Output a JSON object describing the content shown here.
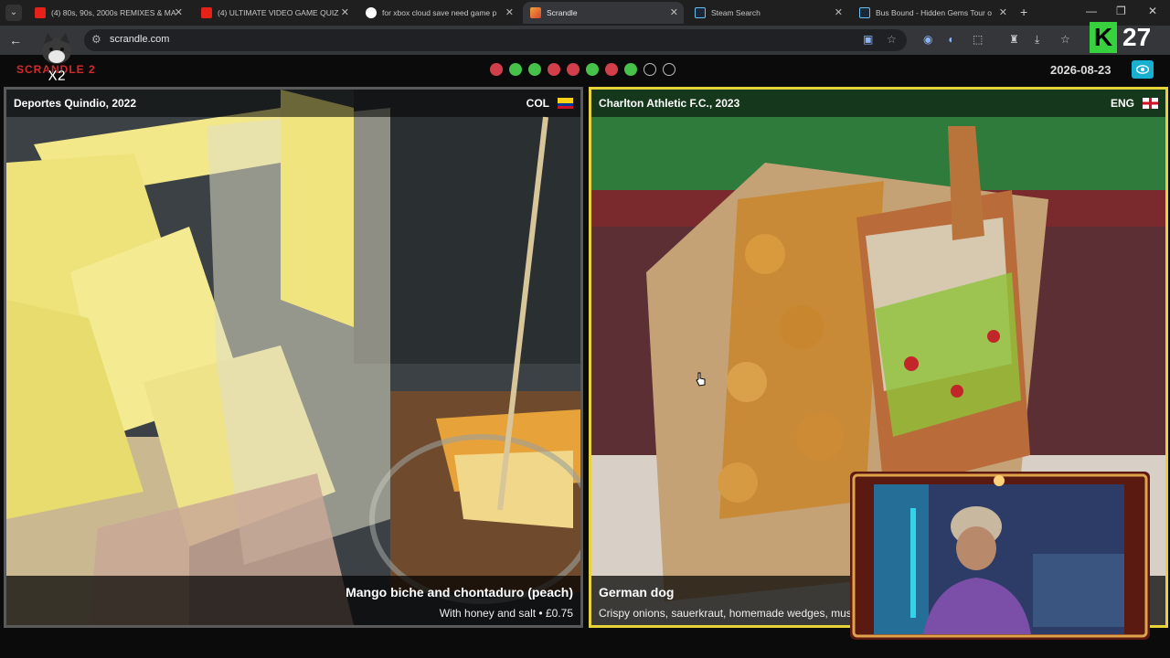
{
  "browser": {
    "tabs": [
      {
        "title": "(4) 80s, 90s, 2000s REMIXES & MA",
        "icon": "youtube-icon",
        "active": false
      },
      {
        "title": "(4) ULTIMATE VIDEO GAME QUIZ",
        "icon": "youtube-icon",
        "active": false
      },
      {
        "title": "for xbox cloud save need game p",
        "icon": "google-icon",
        "active": false
      },
      {
        "title": "Scrandle",
        "icon": "scrandle-icon",
        "active": true
      },
      {
        "title": "Steam Search",
        "icon": "steam-icon",
        "active": false
      },
      {
        "title": "Bus Bound - Hidden Gems Tour o",
        "icon": "steam-icon",
        "active": false
      }
    ],
    "url": "scrandle.com",
    "overlay_badge": {
      "letter": "K",
      "number": "27"
    }
  },
  "game": {
    "logo": "SCRANDLE 2",
    "streak_badge": "X2",
    "progress": [
      "wrong",
      "right",
      "right",
      "wrong",
      "wrong",
      "right",
      "wrong",
      "right",
      "empty",
      "empty"
    ],
    "date": "2026-08-23",
    "colors": {
      "wrong": "#d1404a",
      "right": "#46c14a",
      "selected_border": "#e6d33a",
      "accent": "#18b0d0"
    }
  },
  "cards": {
    "left": {
      "team": "Deportes Quindio, 2022",
      "country": "COL",
      "dish": "Mango biche and chontaduro (peach)",
      "description": "With honey and salt • £0.75"
    },
    "right": {
      "team": "Charlton Athletic F.C., 2023",
      "country": "ENG",
      "dish": "German dog",
      "description": "Crispy onions, sauerkraut, homemade wedges, mus"
    }
  }
}
